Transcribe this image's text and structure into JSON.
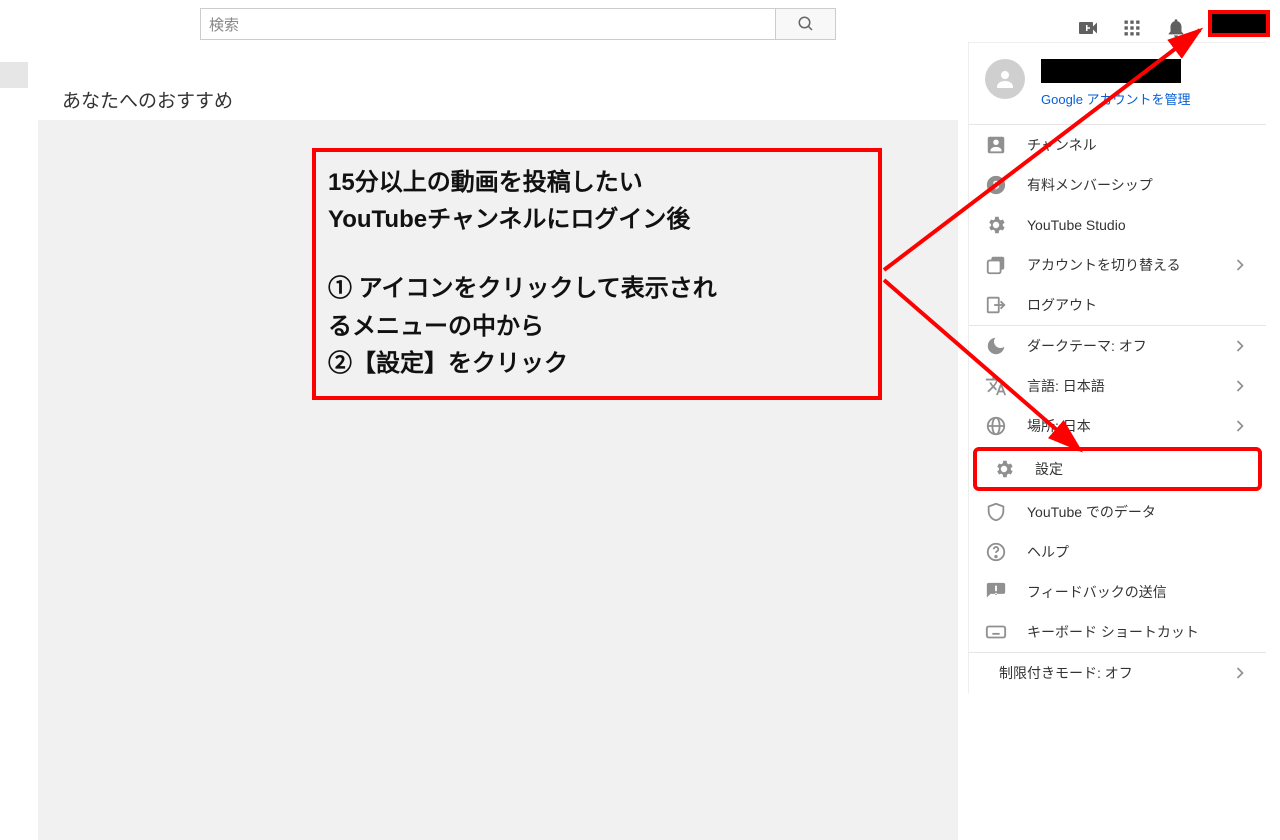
{
  "header": {
    "search_placeholder": "検索"
  },
  "main": {
    "recommend_title": "あなたへのおすすめ"
  },
  "callout": {
    "line1": "15分以上の動画を投稿したい",
    "line2": "YouTubeチャンネルにログイン後",
    "line3": "① アイコンをクリックして表示され",
    "line4": "るメニューの中から",
    "line5": "②【設定】をクリック"
  },
  "menu": {
    "manage": "Google アカウントを管理",
    "channel": "チャンネル",
    "paid": "有料メンバーシップ",
    "studio": "YouTube Studio",
    "switch": "アカウントを切り替える",
    "signout": "ログアウト",
    "dark": "ダークテーマ: オフ",
    "lang": "言語: 日本語",
    "loc": "場所: 日本",
    "settings": "設定",
    "data": "YouTube でのデータ",
    "help": "ヘルプ",
    "feedback": "フィードバックの送信",
    "shortcuts": "キーボード ショートカット",
    "restricted": "制限付きモード: オフ"
  }
}
